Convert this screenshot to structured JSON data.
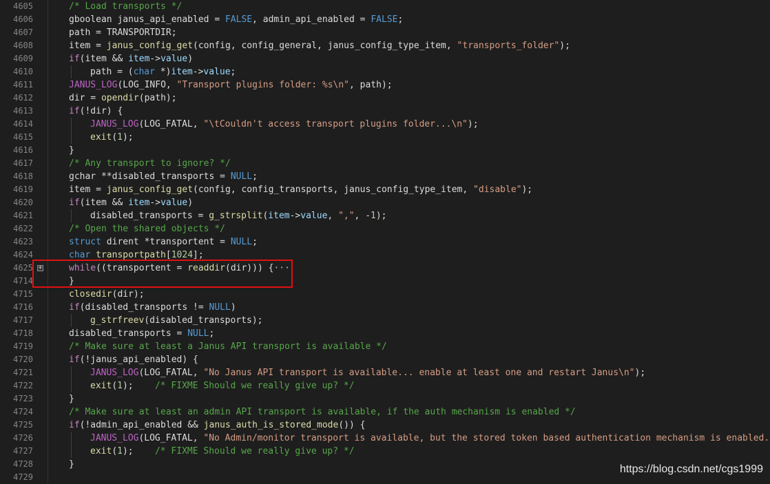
{
  "watermark": "https://blog.csdn.net/cgs1999",
  "lines": [
    {
      "n": "4605",
      "ind": 1,
      "tokens": [
        [
          "cmt",
          "/* Load transports */"
        ]
      ]
    },
    {
      "n": "4606",
      "ind": 1,
      "tokens": [
        [
          "id",
          "gboolean janus_api_enabled = "
        ],
        [
          "kw",
          "FALSE"
        ],
        [
          "id",
          ", admin_api_enabled = "
        ],
        [
          "kw",
          "FALSE"
        ],
        [
          "id",
          ";"
        ]
      ]
    },
    {
      "n": "4607",
      "ind": 1,
      "tokens": [
        [
          "id",
          "path = TRANSPORTDIR;"
        ]
      ]
    },
    {
      "n": "4608",
      "ind": 1,
      "tokens": [
        [
          "id",
          "item = "
        ],
        [
          "fn",
          "janus_config_get"
        ],
        [
          "id",
          "(config, config_general, janus_config_type_item, "
        ],
        [
          "str",
          "\"transports_folder\""
        ],
        [
          "id",
          ");"
        ]
      ]
    },
    {
      "n": "4609",
      "ind": 1,
      "tokens": [
        [
          "ctl",
          "if"
        ],
        [
          "id",
          "(item && "
        ],
        [
          "mem",
          "item"
        ],
        [
          "id",
          "->"
        ],
        [
          "mem",
          "value"
        ],
        [
          "id",
          ")"
        ]
      ]
    },
    {
      "n": "4610",
      "ind": 2,
      "tokens": [
        [
          "id",
          "path = ("
        ],
        [
          "kw",
          "char"
        ],
        [
          "id",
          " *)"
        ],
        [
          "mem",
          "item"
        ],
        [
          "id",
          "->"
        ],
        [
          "mem",
          "value"
        ],
        [
          "id",
          ";"
        ]
      ]
    },
    {
      "n": "4611",
      "ind": 1,
      "tokens": [
        [
          "mac",
          "JANUS_LOG"
        ],
        [
          "id",
          "(LOG_INFO, "
        ],
        [
          "str",
          "\"Transport plugins folder: %s\\n\""
        ],
        [
          "id",
          ", path);"
        ]
      ]
    },
    {
      "n": "4612",
      "ind": 1,
      "tokens": [
        [
          "id",
          "dir = "
        ],
        [
          "fn",
          "opendir"
        ],
        [
          "id",
          "(path);"
        ]
      ]
    },
    {
      "n": "4613",
      "ind": 1,
      "tokens": [
        [
          "ctl",
          "if"
        ],
        [
          "id",
          "(!dir) {"
        ]
      ]
    },
    {
      "n": "4614",
      "ind": 2,
      "tokens": [
        [
          "mac",
          "JANUS_LOG"
        ],
        [
          "id",
          "(LOG_FATAL, "
        ],
        [
          "str",
          "\"\\tCouldn't access transport plugins folder...\\n\""
        ],
        [
          "id",
          ");"
        ]
      ]
    },
    {
      "n": "4615",
      "ind": 2,
      "tokens": [
        [
          "fn",
          "exit"
        ],
        [
          "id",
          "("
        ],
        [
          "num",
          "1"
        ],
        [
          "id",
          ");"
        ]
      ]
    },
    {
      "n": "4616",
      "ind": 1,
      "tokens": [
        [
          "id",
          "}"
        ]
      ]
    },
    {
      "n": "4617",
      "ind": 1,
      "tokens": [
        [
          "cmt",
          "/* Any transport to ignore? */"
        ]
      ]
    },
    {
      "n": "4618",
      "ind": 1,
      "tokens": [
        [
          "id",
          "gchar **disabled_transports = "
        ],
        [
          "kw",
          "NULL"
        ],
        [
          "id",
          ";"
        ]
      ]
    },
    {
      "n": "4619",
      "ind": 1,
      "tokens": [
        [
          "id",
          "item = "
        ],
        [
          "fn",
          "janus_config_get"
        ],
        [
          "id",
          "(config, config_transports, janus_config_type_item, "
        ],
        [
          "str",
          "\"disable\""
        ],
        [
          "id",
          ");"
        ]
      ]
    },
    {
      "n": "4620",
      "ind": 1,
      "tokens": [
        [
          "ctl",
          "if"
        ],
        [
          "id",
          "(item && "
        ],
        [
          "mem",
          "item"
        ],
        [
          "id",
          "->"
        ],
        [
          "mem",
          "value"
        ],
        [
          "id",
          ")"
        ]
      ]
    },
    {
      "n": "4621",
      "ind": 2,
      "tokens": [
        [
          "id",
          "disabled_transports = "
        ],
        [
          "fn",
          "g_strsplit"
        ],
        [
          "id",
          "("
        ],
        [
          "mem",
          "item"
        ],
        [
          "id",
          "->"
        ],
        [
          "mem",
          "value"
        ],
        [
          "id",
          ", "
        ],
        [
          "str",
          "\",\""
        ],
        [
          "id",
          ", -"
        ],
        [
          "num",
          "1"
        ],
        [
          "id",
          ");"
        ]
      ]
    },
    {
      "n": "4622",
      "ind": 1,
      "tokens": [
        [
          "cmt",
          "/* Open the shared objects */"
        ]
      ]
    },
    {
      "n": "4623",
      "ind": 1,
      "tokens": [
        [
          "kw",
          "struct"
        ],
        [
          "id",
          " dirent *transportent = "
        ],
        [
          "kw",
          "NULL"
        ],
        [
          "id",
          ";"
        ]
      ]
    },
    {
      "n": "4624",
      "ind": 1,
      "tokens": [
        [
          "kw",
          "char"
        ],
        [
          "id",
          " "
        ],
        [
          "fn",
          "transportpath"
        ],
        [
          "id",
          "["
        ],
        [
          "num",
          "1024"
        ],
        [
          "id",
          "];"
        ]
      ]
    },
    {
      "n": "4625",
      "ind": 1,
      "fold": true,
      "tokens": [
        [
          "ctl",
          "while"
        ],
        [
          "id",
          "((transportent = "
        ],
        [
          "fn",
          "readdir"
        ],
        [
          "id",
          "(dir))) {"
        ],
        [
          "ellip",
          "···"
        ]
      ]
    },
    {
      "n": "4714",
      "ind": 1,
      "tokens": [
        [
          "id",
          "}"
        ]
      ]
    },
    {
      "n": "4715",
      "ind": 1,
      "tokens": [
        [
          "fn",
          "closedir"
        ],
        [
          "id",
          "(dir);"
        ]
      ]
    },
    {
      "n": "4716",
      "ind": 1,
      "tokens": [
        [
          "ctl",
          "if"
        ],
        [
          "id",
          "(disabled_transports != "
        ],
        [
          "kw",
          "NULL"
        ],
        [
          "id",
          ")"
        ]
      ]
    },
    {
      "n": "4717",
      "ind": 2,
      "tokens": [
        [
          "fn",
          "g_strfreev"
        ],
        [
          "id",
          "(disabled_transports);"
        ]
      ]
    },
    {
      "n": "4718",
      "ind": 1,
      "tokens": [
        [
          "id",
          "disabled_transports = "
        ],
        [
          "kw",
          "NULL"
        ],
        [
          "id",
          ";"
        ]
      ]
    },
    {
      "n": "4719",
      "ind": 1,
      "tokens": [
        [
          "cmt",
          "/* Make sure at least a Janus API transport is available */"
        ]
      ]
    },
    {
      "n": "4720",
      "ind": 1,
      "tokens": [
        [
          "ctl",
          "if"
        ],
        [
          "id",
          "(!janus_api_enabled) {"
        ]
      ]
    },
    {
      "n": "4721",
      "ind": 2,
      "tokens": [
        [
          "mac",
          "JANUS_LOG"
        ],
        [
          "id",
          "(LOG_FATAL, "
        ],
        [
          "str",
          "\"No Janus API transport is available... enable at least one and restart Janus\\n\""
        ],
        [
          "id",
          ");"
        ]
      ]
    },
    {
      "n": "4722",
      "ind": 2,
      "tokens": [
        [
          "fn",
          "exit"
        ],
        [
          "id",
          "("
        ],
        [
          "num",
          "1"
        ],
        [
          "id",
          ");    "
        ],
        [
          "cmt",
          "/* FIXME Should we really give up? */"
        ]
      ]
    },
    {
      "n": "4723",
      "ind": 1,
      "tokens": [
        [
          "id",
          "}"
        ]
      ]
    },
    {
      "n": "4724",
      "ind": 1,
      "tokens": [
        [
          "cmt",
          "/* Make sure at least an admin API transport is available, if the auth mechanism is enabled */"
        ]
      ]
    },
    {
      "n": "4725",
      "ind": 1,
      "tokens": [
        [
          "ctl",
          "if"
        ],
        [
          "id",
          "(!admin_api_enabled && "
        ],
        [
          "fn",
          "janus_auth_is_stored_mode"
        ],
        [
          "id",
          "()) {"
        ]
      ]
    },
    {
      "n": "4726",
      "ind": 2,
      "tokens": [
        [
          "mac",
          "JANUS_LOG"
        ],
        [
          "id",
          "(LOG_FATAL, "
        ],
        [
          "str",
          "\"No Admin/monitor transport is available, but the stored token based authentication mechanism is enabled..."
        ]
      ]
    },
    {
      "n": "4727",
      "ind": 2,
      "tokens": [
        [
          "fn",
          "exit"
        ],
        [
          "id",
          "("
        ],
        [
          "num",
          "1"
        ],
        [
          "id",
          ");    "
        ],
        [
          "cmt",
          "/* FIXME Should we really give up? */"
        ]
      ]
    },
    {
      "n": "4728",
      "ind": 1,
      "tokens": [
        [
          "id",
          "}"
        ]
      ]
    },
    {
      "n": "4729",
      "ind": 0,
      "tokens": []
    }
  ]
}
